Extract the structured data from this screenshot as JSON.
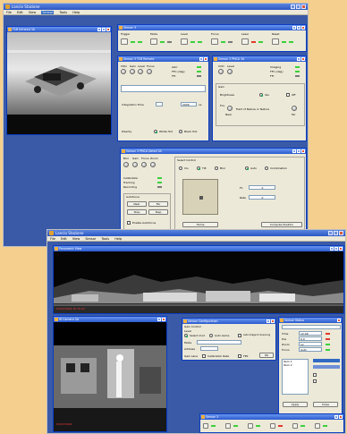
{
  "screen1": {
    "app_title": "Lancio Stazione",
    "menu": [
      "File",
      "Edit",
      "View",
      "Sensor",
      "Tools",
      "Help"
    ],
    "menu_selected": "Sensor",
    "ir_window": {
      "title": "TCB Infrared 3A"
    },
    "toolbar_window": {
      "title": "Sensor 3",
      "sections": [
        "Trigger",
        "Mode",
        "Level",
        "Focus",
        "Laser",
        "Reset"
      ]
    },
    "tcb_window": {
      "title": "Sensor 3 TCB Remote",
      "knob_labels": [
        "Vitro",
        "Gain",
        "Level",
        "Focus"
      ],
      "status": [
        "AGC",
        "FFC (deg)",
        "FFI"
      ],
      "integration_time_label": "Integration Time",
      "integration_time_value": "2000",
      "integration_time_unit": "us",
      "polarity_label": "Polarity",
      "polarity_options": [
        "White Hot",
        "Black Hot"
      ]
    },
    "pmca_window": {
      "title": "Sensor 3 PMCA 3A",
      "knob_labels": [
        "CCD",
        "Level"
      ],
      "status": [
        "Imaging",
        "FFC (deg)",
        "FFI"
      ],
      "group_title": "Gain",
      "gain_label": "Brightness",
      "gain_options": [
        "Yes",
        "Off"
      ],
      "field_label": "Fov",
      "fov_text": "Field of Nature or Nature",
      "slider_ends": [
        "Near",
        "Far"
      ]
    },
    "sensor_window": {
      "title": "Sensor 3 PMCA Detail 3A",
      "knob_labels": [
        "Blur",
        "Gain",
        "Focus",
        "Zoom"
      ],
      "group_title": "Select Control",
      "mode_options": [
        "Iris",
        "Tilt",
        "Blur"
      ],
      "auto_label": "Auto",
      "combo_label": "Combination",
      "status": [
        "Calibration",
        "Tracking",
        "Recording"
      ],
      "field_labels": [
        "Fz",
        "Rate"
      ],
      "field_values": [
        "0",
        "0"
      ],
      "home_button": "Home",
      "compute_button": "Compute Position",
      "sub_group": "Autofocus",
      "sub_buttons": [
        "Near",
        "Far",
        "Stop",
        "Step"
      ],
      "sub_check": "Enable Autofocus"
    }
  },
  "screen2": {
    "app_title": "Lancio Stazione",
    "menu": [
      "File",
      "Edit",
      "View",
      "Sensor",
      "Tools",
      "Help"
    ],
    "pano_window": {
      "title": "Panoramic View",
      "timestamp": "03/07/2004 10:15:22"
    },
    "camera_window": {
      "title": "IR Camera 3A",
      "timestamp": "03/07/2004"
    },
    "config_window": {
      "title": "Sensor Configuration",
      "group_title": "Gain Control",
      "level_label": "Level",
      "radio_labels": [
        "Select mod",
        "Auto Gains"
      ],
      "check_label": "Auto Image to Scanning",
      "field_label": "Mode",
      "addr_label": "Address",
      "stat_labels": [
        "Gain Lane",
        "Calibration Rate",
        "FPS"
      ],
      "ok_button": "OK"
    },
    "side_window": {
      "title": "Sensor Status",
      "labels": [
        "Time",
        "Pos",
        "Zoom",
        "Focus"
      ],
      "values": [
        "12:00",
        "0.0",
        "1x",
        "Auto"
      ],
      "list_items": [
        "Item 1",
        "Item 2"
      ],
      "buttons": [
        "Apply",
        "Close"
      ]
    },
    "mini_toolbar": {
      "title": "Sensor 3"
    }
  },
  "colors": {
    "background": "#f4cf8e",
    "desktop": "#3a5aa8",
    "titlebar": "#2a5ad0",
    "window": "#ece9d8",
    "led_on": "#3bd13b",
    "timestamp": "#ff3b3b"
  }
}
